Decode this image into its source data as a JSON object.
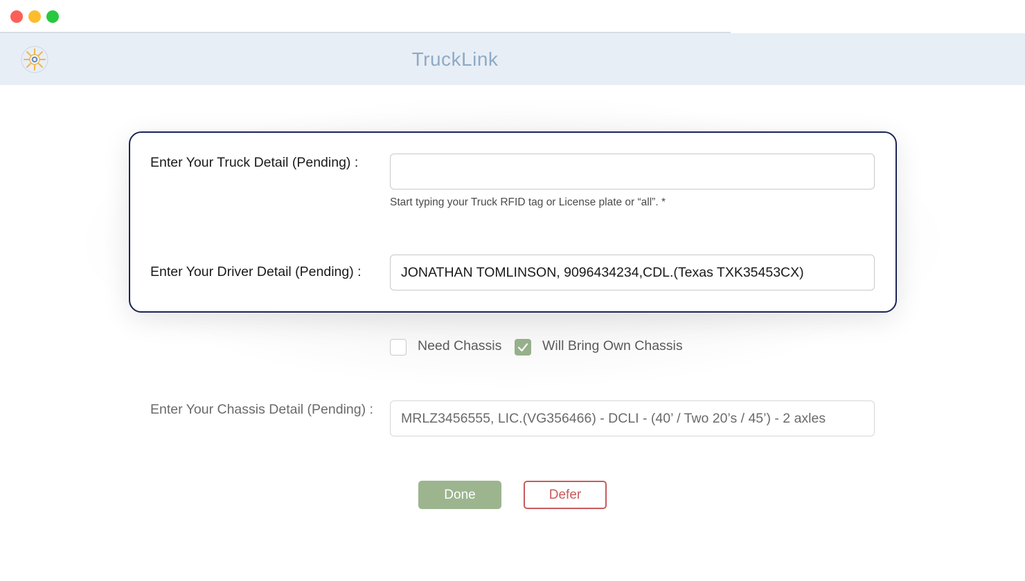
{
  "app": {
    "title": "TruckLink"
  },
  "brand": {
    "accent": "#1b2356",
    "done_color": "#9cb58f",
    "defer_color": "#c85a5e",
    "header_bg": "#e8eef6"
  },
  "icons": {
    "logo": "port-logo-icon",
    "check": "check-icon"
  },
  "form": {
    "truck": {
      "label": "Enter Your Truck Detail (Pending) :",
      "value": "",
      "hint": "Start typing your Truck RFID tag or License plate or “all”. *"
    },
    "driver": {
      "label": "Enter Your Driver Detail (Pending) :",
      "value": "JONATHAN TOMLINSON, 9096434234,CDL.(Texas TXK35453CX)"
    },
    "chassis_options": [
      {
        "label": "Need Chassis",
        "checked": false
      },
      {
        "label": "Will Bring Own Chassis",
        "checked": true
      }
    ],
    "chassis": {
      "label": "Enter Your Chassis Detail (Pending) :",
      "value": "MRLZ3456555, LIC.(VG356466) - DCLI - (40’ / Two 20’s / 45’) - 2 axles"
    }
  },
  "actions": {
    "done": "Done",
    "defer": "Defer"
  }
}
